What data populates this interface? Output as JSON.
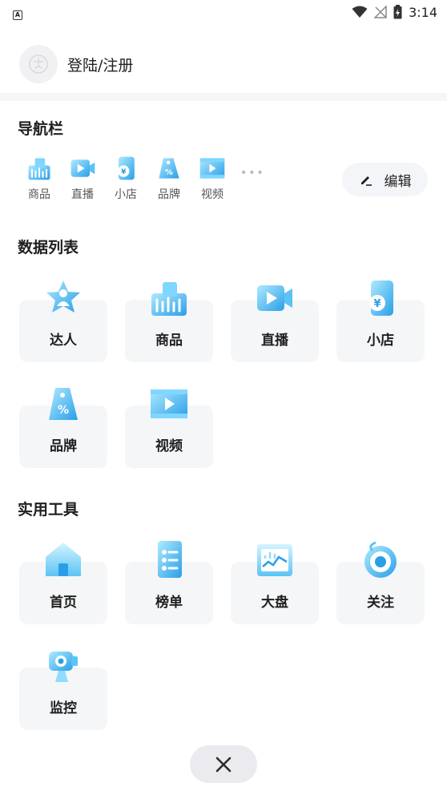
{
  "status": {
    "time": "3:14",
    "left_badge": "A"
  },
  "login": {
    "label": "登陆/注册"
  },
  "nav": {
    "title": "导航栏",
    "items": [
      {
        "label": "商品",
        "icon": "shopping-bags-icon"
      },
      {
        "label": "直播",
        "icon": "live-video-icon"
      },
      {
        "label": "小店",
        "icon": "shop-yen-icon"
      },
      {
        "label": "品牌",
        "icon": "brand-tag-icon"
      },
      {
        "label": "视频",
        "icon": "video-film-icon"
      }
    ],
    "more": "•••",
    "edit_label": "编辑"
  },
  "data_list": {
    "title": "数据列表",
    "items": [
      {
        "label": "达人",
        "icon": "influencer-star-icon"
      },
      {
        "label": "商品",
        "icon": "shopping-bags-icon"
      },
      {
        "label": "直播",
        "icon": "live-video-icon"
      },
      {
        "label": "小店",
        "icon": "shop-yen-icon"
      },
      {
        "label": "品牌",
        "icon": "brand-tag-icon"
      },
      {
        "label": "视频",
        "icon": "video-film-icon"
      }
    ]
  },
  "tools": {
    "title": "实用工具",
    "items": [
      {
        "label": "首页",
        "icon": "home-icon"
      },
      {
        "label": "榜单",
        "icon": "ranking-list-icon"
      },
      {
        "label": "大盘",
        "icon": "market-chart-icon"
      },
      {
        "label": "关注",
        "icon": "follow-target-icon"
      },
      {
        "label": "监控",
        "icon": "monitor-camera-icon"
      }
    ]
  },
  "colors": {
    "accent": "#2fa9f0",
    "accent_light": "#8fdcff",
    "card_bg": "#f5f6f8"
  }
}
